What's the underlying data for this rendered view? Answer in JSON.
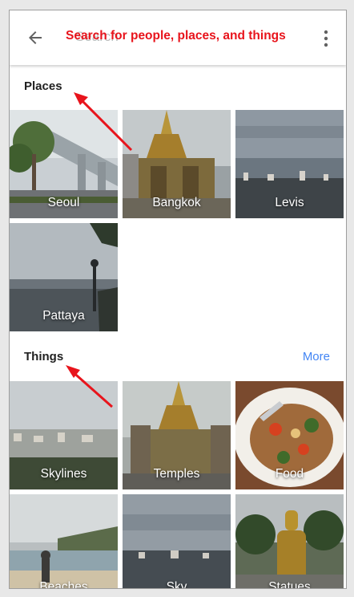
{
  "header": {
    "search_placeholder": "Search",
    "callout": "Search for people, places, and things"
  },
  "places": {
    "title": "Places",
    "items": [
      {
        "label": "Seoul"
      },
      {
        "label": "Bangkok"
      },
      {
        "label": "Levis"
      },
      {
        "label": "Pattaya"
      }
    ]
  },
  "things": {
    "title": "Things",
    "more_label": "More",
    "items": [
      {
        "label": "Skylines"
      },
      {
        "label": "Temples"
      },
      {
        "label": "Food"
      },
      {
        "label": "Beaches"
      },
      {
        "label": "Sky"
      },
      {
        "label": "Statues"
      }
    ]
  },
  "colors": {
    "accent_link": "#4285f4",
    "annotation_red": "#e8141c"
  }
}
